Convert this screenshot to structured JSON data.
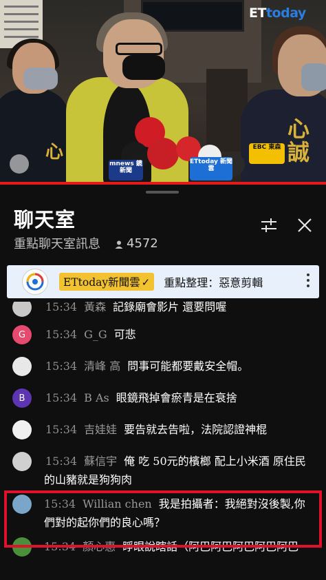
{
  "video": {
    "watermark_prefix": "ET",
    "watermark_suffix": "today",
    "mic_flags": [
      {
        "text": "mnews\n鏡新聞",
        "color": "#ffffff",
        "bg": "#1b3a8a"
      },
      {
        "text": "ETtoday\n新聞雲",
        "color": "#ffffff",
        "bg": "#1d6fd6"
      },
      {
        "text": "EBC\n東森",
        "color": "#111111",
        "bg": "#f2c000"
      }
    ],
    "shirt_text_left": "心",
    "shirt_text_right": "心誠",
    "progress_percent": 100,
    "accent_color": "#e21b1b"
  },
  "chat": {
    "title": "聊天室",
    "subtitle": "重點聊天室訊息",
    "viewer_icon": "person-icon",
    "viewer_count": "4572",
    "filter_icon": "sliders-icon",
    "close_icon": "close-icon"
  },
  "pinned": {
    "channel": "ETtoday新聞雲",
    "verified": "✓",
    "message": "重點整理：惡意剪輯",
    "more_icon": "more-vertical-icon"
  },
  "messages": [
    {
      "time": "15:34",
      "author": "黃森",
      "text": "記錄廟會影片 還要問喔",
      "avatar": {
        "type": "photo",
        "color": "#c8c8c8"
      }
    },
    {
      "time": "15:34",
      "author": "G_G",
      "text": "可悲",
      "avatar": {
        "type": "letter",
        "letter": "G",
        "color": "#e64a6e"
      }
    },
    {
      "time": "15:34",
      "author": "清峰 高",
      "text": "問事可能都要戴安全帽。",
      "avatar": {
        "type": "photo",
        "color": "#e8e8e8"
      }
    },
    {
      "time": "15:34",
      "author": "B As",
      "text": "眼鏡飛掉會瘀青是在衰捨",
      "avatar": {
        "type": "letter",
        "letter": "B",
        "color": "#5e35b1"
      }
    },
    {
      "time": "15:34",
      "author": "吉娃娃",
      "text": "要告就去告啦，法院認證神棍",
      "avatar": {
        "type": "photo",
        "color": "#f0f0f0"
      }
    },
    {
      "time": "15:34",
      "author": "蘇信宇",
      "text": "俺 吃 50元的檳榔 配上小米酒 原住民的山豬就是狗狗肉",
      "avatar": {
        "type": "photo",
        "color": "#d0d0d0"
      }
    },
    {
      "time": "15:34",
      "author": "Willian chen",
      "text": "我是拍攝者：我絕對沒後製,你們對的起你們的良心嗎？",
      "avatar": {
        "type": "photo",
        "color": "#7aa7c9"
      }
    },
    {
      "time": "15:34",
      "author": "顏心惠",
      "text": "睜眼說瞎話（阿巴阿巴阿巴阿巴阿巴",
      "avatar": {
        "type": "photo",
        "color": "#4b8f3a"
      }
    }
  ],
  "highlight_color": "#e0112b"
}
